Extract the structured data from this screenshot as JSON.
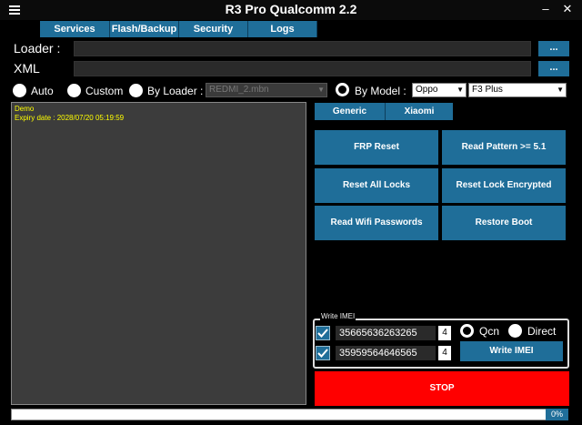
{
  "window": {
    "title": "R3 Pro Qualcomm 2.2",
    "minimize_glyph": "–",
    "close_glyph": "✕",
    "menu_icon": "hamburger-icon"
  },
  "tabs": [
    "Services",
    "Flash/Backup",
    "Security",
    "Logs"
  ],
  "loader": {
    "label": "Loader :",
    "value": "",
    "browse_label": "..."
  },
  "xml": {
    "label": "XML",
    "value": "",
    "browse_label": "..."
  },
  "mode": {
    "auto_label": "Auto",
    "custom_label": "Custom",
    "by_loader_label": "By Loader :",
    "by_loader_value": "REDMI_2.mbn",
    "by_model_label": "By Model :",
    "brand_value": "Oppo",
    "model_value": "F3 Plus",
    "selected": "By Model"
  },
  "log": {
    "line1": "Demo",
    "line2": "Expiry date : 2028/07/20 05:19:59",
    "line1_color": "#ffff00",
    "line2_color": "#ffff00"
  },
  "subtabs": [
    "Generic",
    "Xiaomi"
  ],
  "actions": {
    "frp_reset": "FRP Reset",
    "read_pattern": "Read Pattern >= 5.1",
    "reset_all_locks": "Reset All Locks",
    "reset_lock_encrypted": "Reset Lock Encrypted",
    "read_wifi": "Read Wifi Passwords",
    "restore_boot": "Restore Boot"
  },
  "write_imei": {
    "legend": "Write IMEI",
    "imei1": "35665636263265",
    "imei1_digit": "4",
    "imei1_checked": true,
    "imei2": "35959564646565",
    "imei2_digit": "4",
    "imei2_checked": true,
    "qcn_label": "Qcn",
    "direct_label": "Direct",
    "mode_selected": "Qcn",
    "button_label": "Write IMEI"
  },
  "stop_label": "STOP",
  "progress": {
    "percent": 0,
    "label": "0%"
  },
  "colors": {
    "accent": "#1f6e99",
    "stop": "#ff0000",
    "background": "#000000",
    "log_bg": "#3c3c3c"
  }
}
